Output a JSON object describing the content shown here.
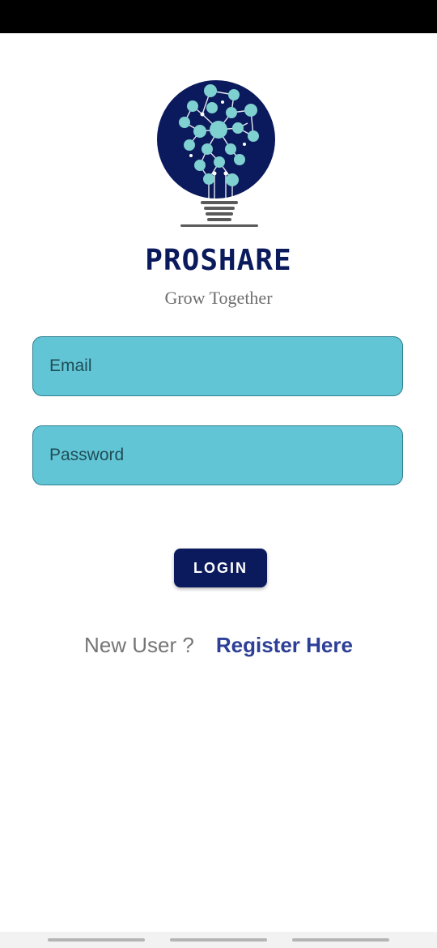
{
  "app": {
    "name": "PROSHARE",
    "tagline": "Grow Together"
  },
  "colors": {
    "brand_navy": "#0b1a5c",
    "field_fill": "#62c5d6",
    "node_teal": "#7fd0d0",
    "link_blue": "#2d3f96",
    "tagline_gray": "#6e6e6e",
    "field_text": "#1f4d56"
  },
  "icons": {
    "logo": "lightbulb-network-icon"
  },
  "form": {
    "email_placeholder": "Email",
    "password_placeholder": "Password",
    "login_label": "LOGIN"
  },
  "footer": {
    "new_user_text": "New User ?",
    "register_label": "Register Here"
  }
}
